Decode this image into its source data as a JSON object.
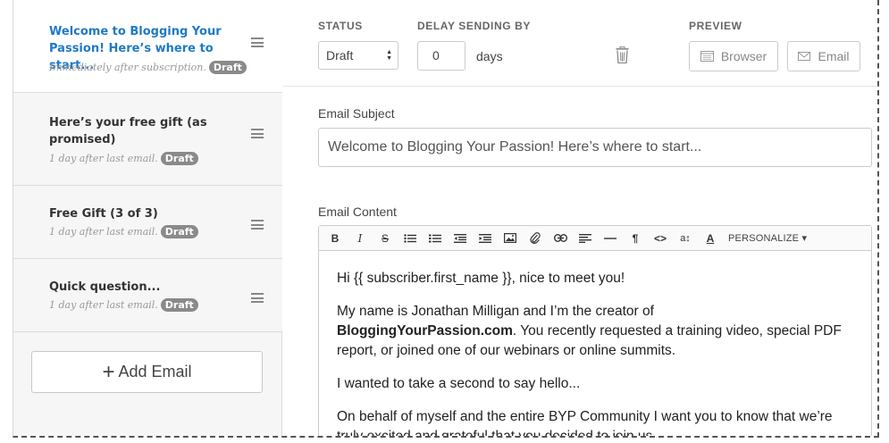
{
  "sidebar": {
    "emails": [
      {
        "title": "Welcome to Blogging Your Passion! Here’s where to start...",
        "timing": "Immediately after subscription.",
        "badge": "Draft"
      },
      {
        "title": "Here’s your free gift (as promised)",
        "timing": "1 day after last email.",
        "badge": "Draft"
      },
      {
        "title": "Free Gift (3 of 3)",
        "timing": "1 day after last email.",
        "badge": "Draft"
      },
      {
        "title": "Quick question...",
        "timing": "1 day after last email.",
        "badge": "Draft"
      }
    ],
    "add_label": "Add Email"
  },
  "toolbar": {
    "status_label": "STATUS",
    "status_value": "Draft",
    "delay_label": "DELAY SENDING BY",
    "delay_value": "0",
    "delay_unit": "days",
    "preview_label": "PREVIEW",
    "preview_browser": "Browser",
    "preview_email": "Email"
  },
  "form": {
    "subject_label": "Email Subject",
    "subject_value": "Welcome to Blogging Your Passion! Here’s where to start...",
    "content_label": "Email Content",
    "personalize_label": "PERSONALIZE",
    "body": {
      "p1": "Hi {{ subscriber.first_name }}, nice to meet you!",
      "p2_a": "My name is Jonathan Milligan and I’m the creator of",
      "p2_b": "BloggingYourPassion.com",
      "p2_c": ". You recently requested a training video, special PDF report, or joined one of our webinars or online summits.",
      "p3": "I wanted to take a second to say hello...",
      "p4": "On behalf of myself and the entire BYP Community I want you to know that we’re truly excited and grateful that you decided to join us."
    }
  },
  "colors": {
    "accent": "#1e7ac5",
    "badge": "#8a8a8a"
  }
}
